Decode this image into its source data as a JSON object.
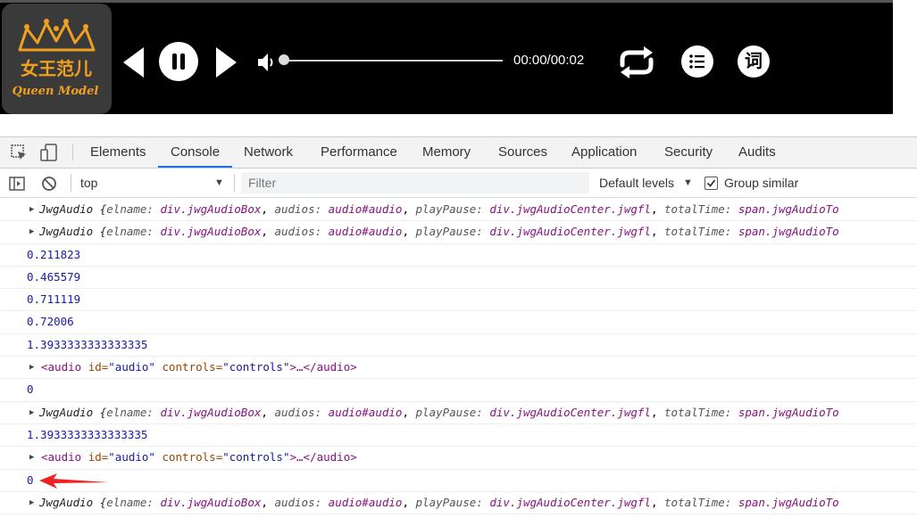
{
  "player": {
    "cover_line1": "女王范儿",
    "cover_line2": "Queen Model",
    "time": "00:00/00:02",
    "lyric_button": "词",
    "progress": 0.0
  },
  "devtools": {
    "tabs": [
      "Elements",
      "Console",
      "Network",
      "Performance",
      "Memory",
      "Sources",
      "Application",
      "Security",
      "Audits"
    ],
    "active_tab": "Console",
    "context": "top",
    "filter_placeholder": "Filter",
    "levels": "Default levels",
    "group_similar": "Group similar",
    "group_similar_checked": true
  },
  "console": {
    "obj": {
      "name": "JwgAudio",
      "open": "{",
      "k1": "elname:",
      "v1": "div.jwgAudioBox",
      "k2": "audios:",
      "v2": "audio#audio",
      "k3": "playPause:",
      "v3": "div.jwgAudioCenter.jwgfl",
      "k4": "totalTime:",
      "v4": "span.jwgAudioTo"
    },
    "elem": {
      "open_tag": "<audio",
      "attr1": "id=",
      "attr1_val": "\"audio\"",
      "attr2": "controls=",
      "attr2_val": "\"controls\"",
      "mid": ">…",
      "close_tag": "</audio>"
    },
    "numbers": [
      "0.211823",
      "0.465579",
      "0.711119",
      "0.72006",
      "1.3933333333333335",
      "0",
      "1.3933333333333335",
      "0"
    ]
  }
}
